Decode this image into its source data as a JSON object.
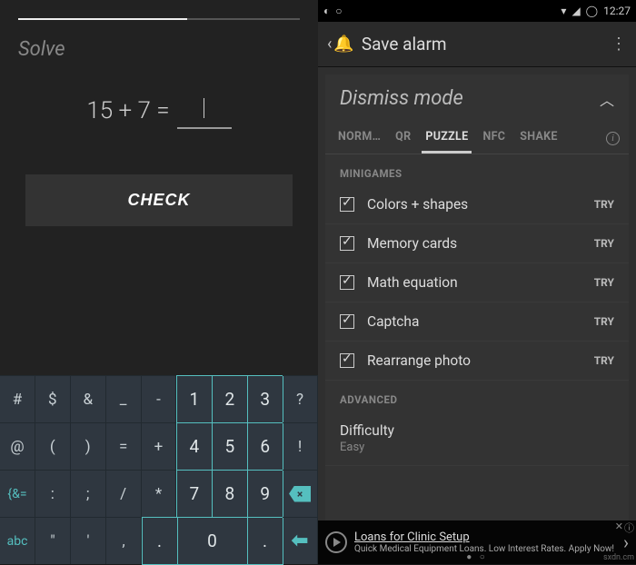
{
  "left": {
    "solve_label": "Solve",
    "equation": "15 + 7 =",
    "answer_value": "",
    "check_label": "CHECK",
    "keyboard": {
      "row1": [
        "#",
        "$",
        "&",
        "_",
        "-",
        "1",
        "2",
        "3",
        "?"
      ],
      "row2": [
        "@",
        "(",
        ")",
        "=",
        "+",
        "4",
        "5",
        "6",
        "!"
      ],
      "row3": [
        "{&=",
        ":",
        ";",
        "/",
        "*",
        "7",
        "8",
        "9"
      ],
      "row4": [
        "abc",
        "\"",
        "'",
        ",",
        ".",
        "0"
      ],
      "backspace_glyph": "×",
      "enter_glyph": "↵"
    }
  },
  "right": {
    "status": {
      "time": "12:27"
    },
    "titlebar": {
      "title": "Save alarm"
    },
    "card": {
      "heading": "Dismiss mode",
      "tabs": [
        "NORM…",
        "QR",
        "PUZZLE",
        "NFC",
        "SHAKE"
      ],
      "active_tab_index": 2,
      "minigames_label": "MINIGAMES",
      "minigames": [
        {
          "label": "Colors + shapes",
          "checked": true,
          "try": "TRY"
        },
        {
          "label": "Memory cards",
          "checked": true,
          "try": "TRY"
        },
        {
          "label": "Math equation",
          "checked": true,
          "try": "TRY"
        },
        {
          "label": "Captcha",
          "checked": true,
          "try": "TRY"
        },
        {
          "label": "Rearrange photo",
          "checked": true,
          "try": "TRY"
        }
      ],
      "advanced_label": "ADVANCED",
      "difficulty_label": "Difficulty",
      "difficulty_value": "Easy"
    },
    "ad": {
      "title": "Loans for Clinic Setup",
      "sub": "Quick Medical Equipment Loans. Low Interest Rates. Apply Now!"
    }
  },
  "watermark": "sxdn.cm"
}
